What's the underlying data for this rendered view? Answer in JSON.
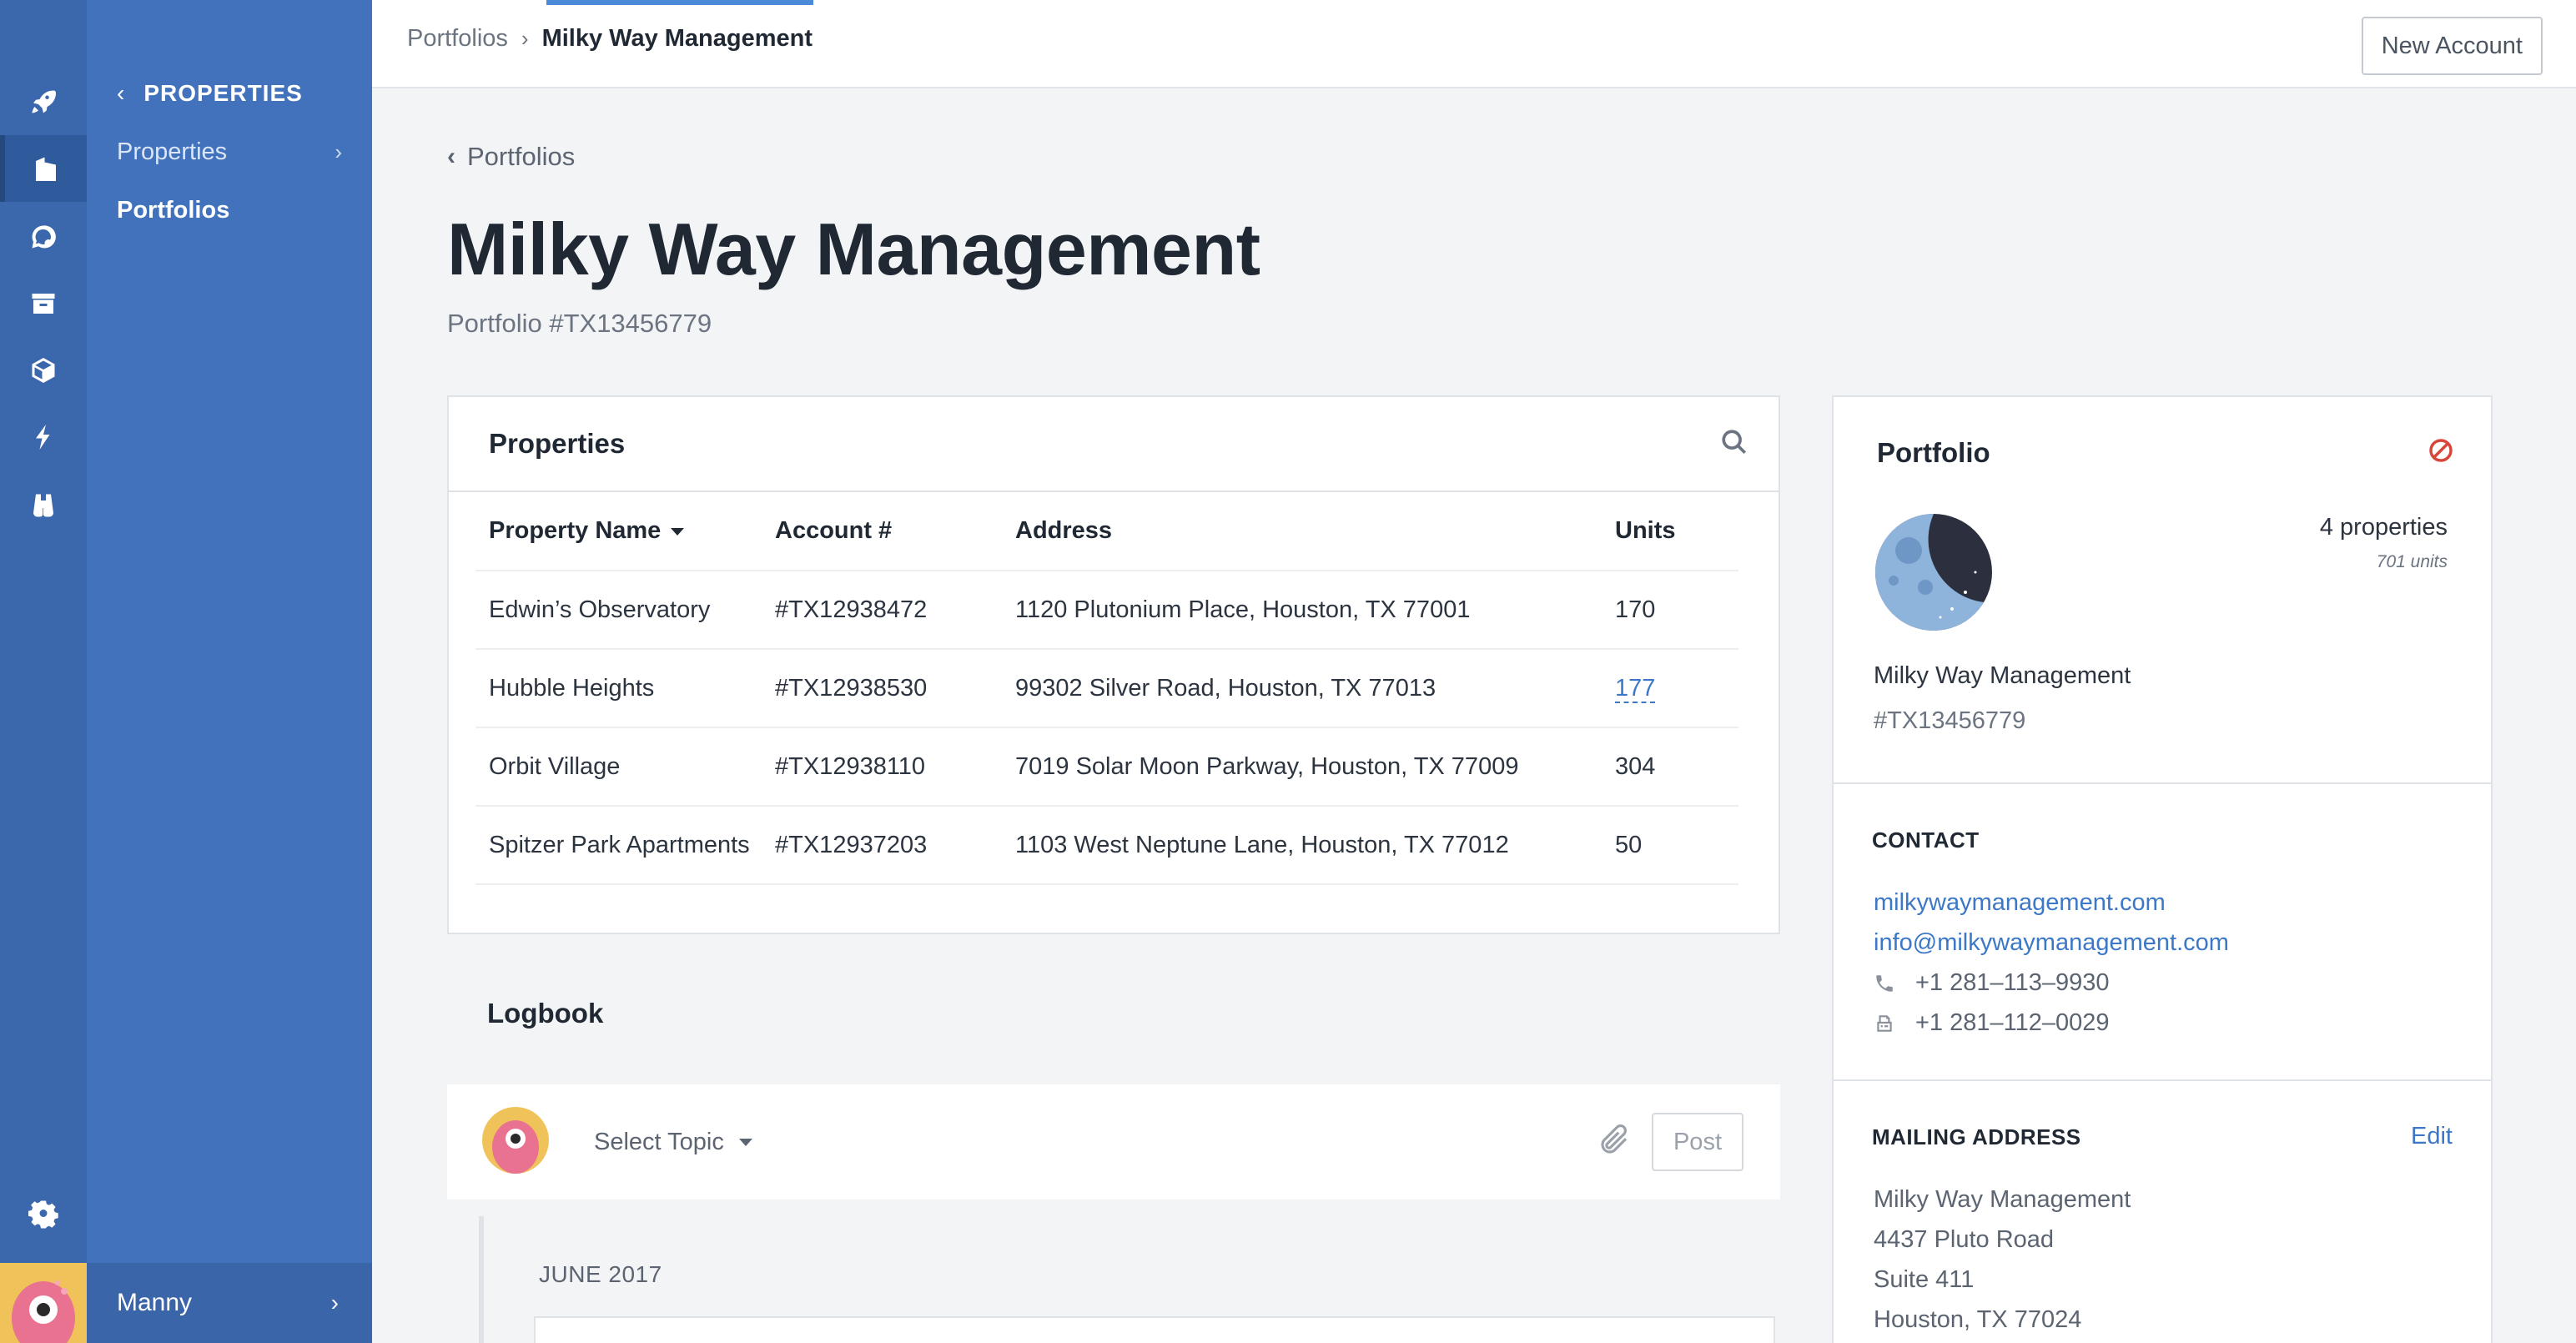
{
  "nav": {
    "section_label": "PROPERTIES",
    "items": [
      {
        "label": "Properties"
      },
      {
        "label": "Portfolios"
      }
    ],
    "user_name": "Manny"
  },
  "rail": {
    "icons": [
      "rocket-icon",
      "building-icon",
      "chat-icon",
      "archive-icon",
      "box-icon",
      "bolt-icon",
      "binoculars-icon",
      "gear-icon"
    ]
  },
  "topbar": {
    "breadcrumb_parent": "Portfolios",
    "breadcrumb_current": "Milky Way Management",
    "new_account_label": "New Account"
  },
  "header": {
    "back_label": "Portfolios",
    "title": "Milky Way Management",
    "subtitle": "Portfolio #TX13456779"
  },
  "properties": {
    "title": "Properties",
    "columns": [
      "Property Name",
      "Account #",
      "Address",
      "Units"
    ],
    "rows": [
      {
        "name": "Edwin’s Observatory",
        "account": "#TX12938472",
        "address": "1120 Plutonium Place, Houston, TX 77001",
        "units": "170"
      },
      {
        "name": "Hubble Heights",
        "account": "#TX12938530",
        "address": "99302 Silver Road, Houston, TX 77013",
        "units": "177"
      },
      {
        "name": "Orbit Village",
        "account": "#TX12938110",
        "address": "7019 Solar Moon Parkway, Houston, TX 77009",
        "units": "304"
      },
      {
        "name": "Spitzer Park Apartments",
        "account": "#TX12937203",
        "address": "1103 West Neptune Lane, Houston, TX 77012",
        "units": "50"
      }
    ]
  },
  "logbook": {
    "title": "Logbook",
    "topic_placeholder": "Select Topic",
    "post_label": "Post",
    "month_label": "JUNE 2017"
  },
  "portfolio": {
    "title": "Portfolio",
    "property_count": "4 properties",
    "unit_count": "701 units",
    "name": "Milky Way Management",
    "id": "#TX13456779",
    "contact_label": "CONTACT",
    "website": "milkywaymanagement.com",
    "email": "info@milkywaymanagement.com",
    "phone": "+1 281–113–9930",
    "fax": "+1 281–112–0029",
    "mailing_label": "MAILING ADDRESS",
    "edit_label": "Edit",
    "address_lines": [
      "Milky Way Management",
      "4437 Pluto Road",
      "Suite 411",
      "Houston, TX 77024"
    ]
  },
  "colors": {
    "rail": "#3b68ad",
    "nav": "#4372bd",
    "link": "#3c78c6",
    "accent_underline": "#4a8ad6",
    "danger": "#d9453b"
  }
}
